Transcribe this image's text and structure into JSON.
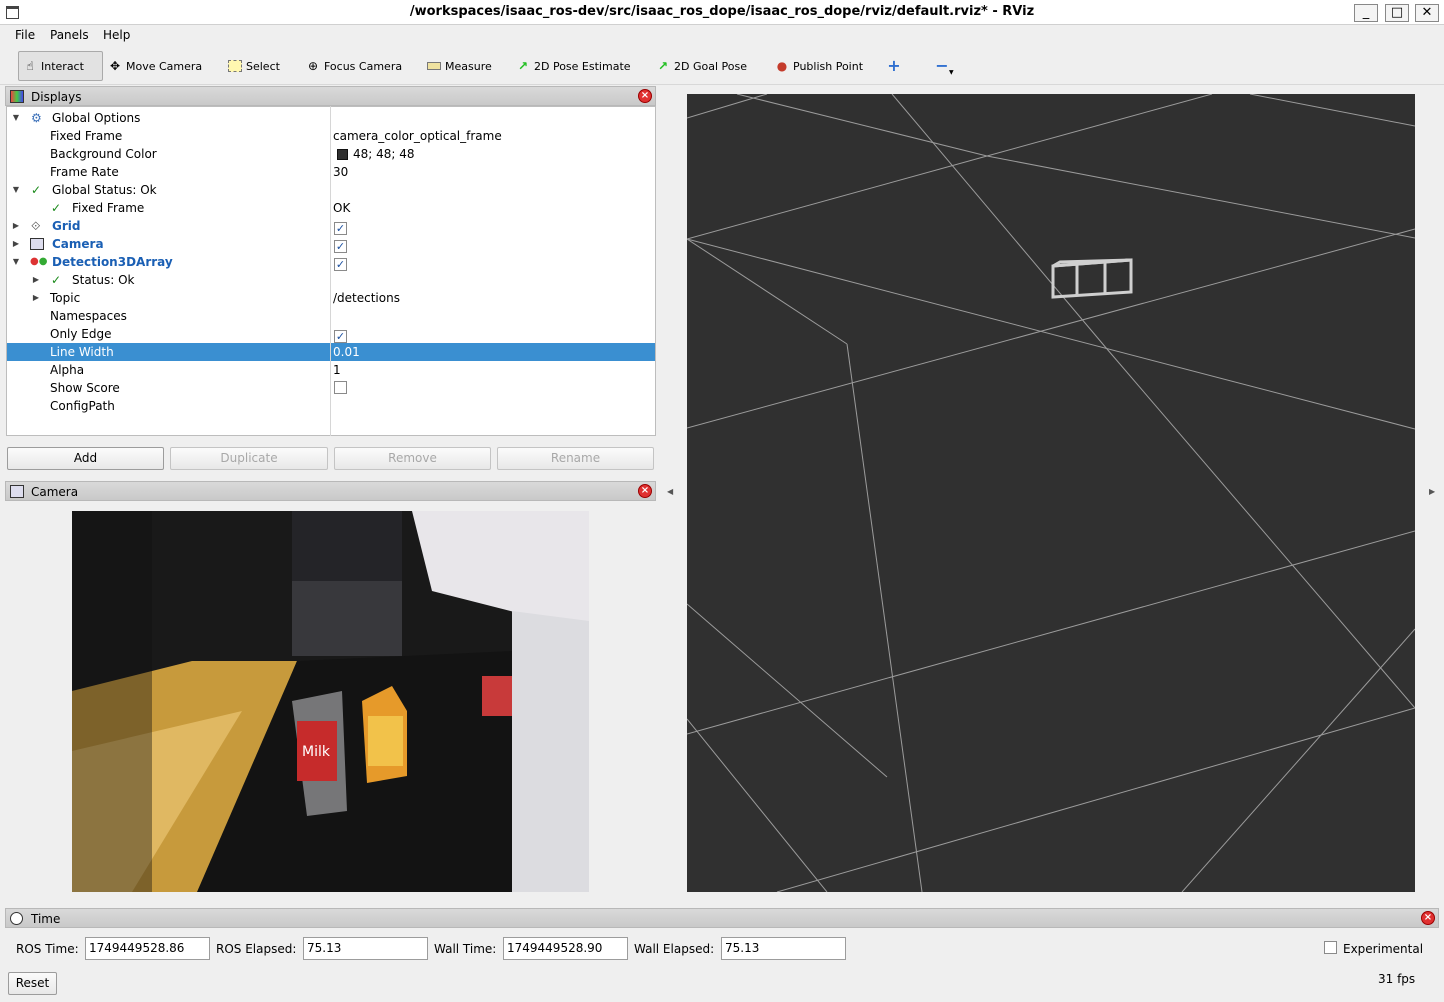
{
  "window": {
    "title": "/workspaces/isaac_ros-dev/src/isaac_ros_dope/isaac_ros_dope/rviz/default.rviz* - RViz",
    "minimize": "_",
    "maximize": "□",
    "close": "✕"
  },
  "menu": [
    "File",
    "Panels",
    "Help"
  ],
  "toolbar": {
    "interact": "Interact",
    "move_camera": "Move Camera",
    "select": "Select",
    "focus_camera": "Focus Camera",
    "measure": "Measure",
    "pose_estimate": "2D Pose Estimate",
    "goal_pose": "2D Goal Pose",
    "publish_point": "Publish Point"
  },
  "displays": {
    "title": "Displays",
    "rows": [
      {
        "label": "Global Options",
        "value": ""
      },
      {
        "label": "Fixed Frame",
        "value": "camera_color_optical_frame"
      },
      {
        "label": "Background Color",
        "value": "48; 48; 48"
      },
      {
        "label": "Frame Rate",
        "value": "30"
      },
      {
        "label": "Global Status: Ok",
        "value": ""
      },
      {
        "label": "Fixed Frame",
        "value": "OK"
      },
      {
        "label": "Grid",
        "value": ""
      },
      {
        "label": "Camera",
        "value": ""
      },
      {
        "label": "Detection3DArray",
        "value": ""
      },
      {
        "label": "Status: Ok",
        "value": ""
      },
      {
        "label": "Topic",
        "value": "/detections"
      },
      {
        "label": "Namespaces",
        "value": ""
      },
      {
        "label": "Only Edge",
        "value": ""
      },
      {
        "label": "Line Width",
        "value": "0.01"
      },
      {
        "label": "Alpha",
        "value": "1"
      },
      {
        "label": "Show Score",
        "value": ""
      },
      {
        "label": "ConfigPath",
        "value": ""
      }
    ],
    "checks": {
      "grid": true,
      "camera": true,
      "detection": true,
      "only_edge": true,
      "show_score": false
    },
    "background_color": "#303030",
    "buttons": {
      "add": "Add",
      "duplicate": "Duplicate",
      "remove": "Remove",
      "rename": "Rename"
    }
  },
  "camera_panel": {
    "title": "Camera"
  },
  "time_panel": {
    "title": "Time",
    "ros_time_label": "ROS Time:",
    "ros_time": "1749449528.86",
    "ros_elapsed_label": "ROS Elapsed:",
    "ros_elapsed": "75.13",
    "wall_time_label": "Wall Time:",
    "wall_time": "1749449528.90",
    "wall_elapsed_label": "Wall Elapsed:",
    "wall_elapsed": "75.13",
    "experimental_label": "Experimental",
    "reset_label": "Reset",
    "fps": "31 fps"
  },
  "colors": {
    "selection": "#3a8fd1",
    "view_background": "#303030",
    "grid_line": "#a0a0a0",
    "link_blue": "#1a5fb4",
    "ok_green": "#1a8a1a"
  }
}
